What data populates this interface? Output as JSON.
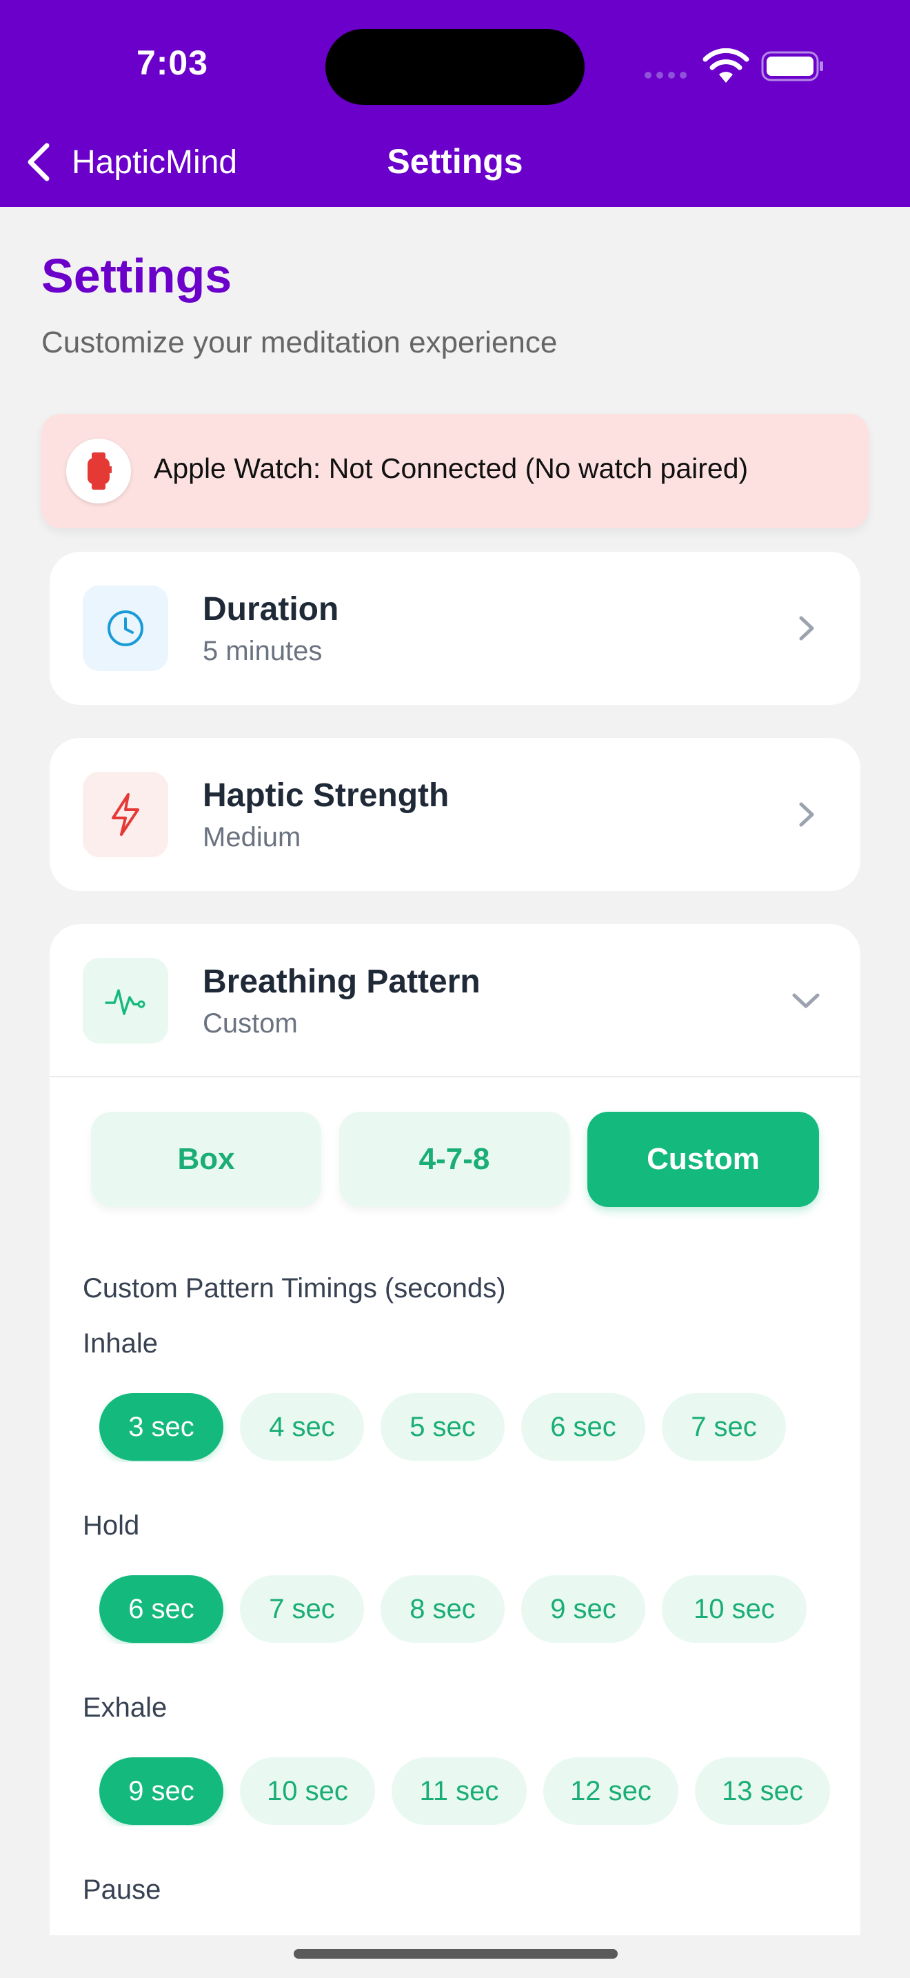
{
  "status_bar": {
    "time": "7:03"
  },
  "nav": {
    "back_label": "HapticMind",
    "title": "Settings"
  },
  "header": {
    "title": "Settings",
    "subtitle": "Customize your meditation experience"
  },
  "watch_banner": {
    "text": "Apple Watch: Not Connected (No watch paired)",
    "icon": "watch-icon"
  },
  "settings": {
    "duration": {
      "title": "Duration",
      "value": "5 minutes",
      "icon": "clock-icon"
    },
    "haptic": {
      "title": "Haptic Strength",
      "value": "Medium",
      "icon": "bolt-icon"
    },
    "breathing": {
      "title": "Breathing Pattern",
      "value": "Custom",
      "icon": "heartbeat-icon",
      "options": [
        "Box",
        "4-7-8",
        "Custom"
      ],
      "selected": "Custom",
      "custom_heading": "Custom Pattern Timings (seconds)",
      "inhale": {
        "label": "Inhale",
        "options": [
          "3 sec",
          "4 sec",
          "5 sec",
          "6 sec",
          "7 sec"
        ],
        "selected": "3 sec"
      },
      "hold": {
        "label": "Hold",
        "options": [
          "6 sec",
          "7 sec",
          "8 sec",
          "9 sec",
          "10 sec"
        ],
        "selected": "6 sec"
      },
      "exhale": {
        "label": "Exhale",
        "options": [
          "9 sec",
          "10 sec",
          "11 sec",
          "12 sec",
          "13 sec"
        ],
        "selected": "9 sec"
      },
      "pause": {
        "label": "Pause"
      }
    }
  },
  "colors": {
    "brand": "#6a00c9",
    "accent_green": "#14b97e",
    "pill_bg": "#e9f9f1",
    "banner_bg": "#fde1e1",
    "danger_red": "#e53935",
    "clock_blue": "#1a9bd7"
  }
}
